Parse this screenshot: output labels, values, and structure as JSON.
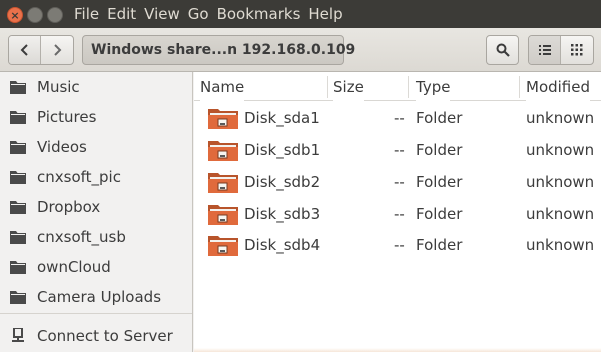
{
  "window": {
    "close_glyph": "×",
    "min_glyph": "–",
    "max_glyph": "□"
  },
  "menubar": {
    "items": [
      "File",
      "Edit",
      "View",
      "Go",
      "Bookmarks",
      "Help"
    ]
  },
  "toolbar": {
    "location": "Windows share...n 192.168.0.109",
    "back_icon": "chevron-left-icon",
    "forward_icon": "chevron-right-icon",
    "search_icon": "search-icon",
    "list_view_icon": "list-view-icon",
    "grid_view_icon": "grid-view-icon"
  },
  "sidebar": {
    "items": [
      {
        "label": "Music",
        "icon": "folder-icon"
      },
      {
        "label": "Pictures",
        "icon": "folder-icon"
      },
      {
        "label": "Videos",
        "icon": "folder-icon"
      },
      {
        "label": "cnxsoft_pic",
        "icon": "folder-icon"
      },
      {
        "label": "Dropbox",
        "icon": "folder-icon"
      },
      {
        "label": "cnxsoft_usb",
        "icon": "folder-icon"
      },
      {
        "label": "ownCloud",
        "icon": "folder-icon"
      },
      {
        "label": "Camera Uploads",
        "icon": "folder-icon"
      }
    ],
    "connect": {
      "label": "Connect to Server",
      "icon": "network-server-icon"
    }
  },
  "filelist": {
    "columns": {
      "name": "Name",
      "size": "Size",
      "type": "Type",
      "modified": "Modified"
    },
    "rows": [
      {
        "name": "Disk_sda1",
        "size": "--",
        "type": "Folder",
        "modified": "unknown"
      },
      {
        "name": "Disk_sdb1",
        "size": "--",
        "type": "Folder",
        "modified": "unknown"
      },
      {
        "name": "Disk_sdb2",
        "size": "--",
        "type": "Folder",
        "modified": "unknown"
      },
      {
        "name": "Disk_sdb3",
        "size": "--",
        "type": "Folder",
        "modified": "unknown"
      },
      {
        "name": "Disk_sdb4",
        "size": "--",
        "type": "Folder",
        "modified": "unknown"
      }
    ]
  },
  "colors": {
    "titlebar": "#3c3b37",
    "close_button": "#e9714b",
    "folder_orange": "#e06a3c"
  }
}
